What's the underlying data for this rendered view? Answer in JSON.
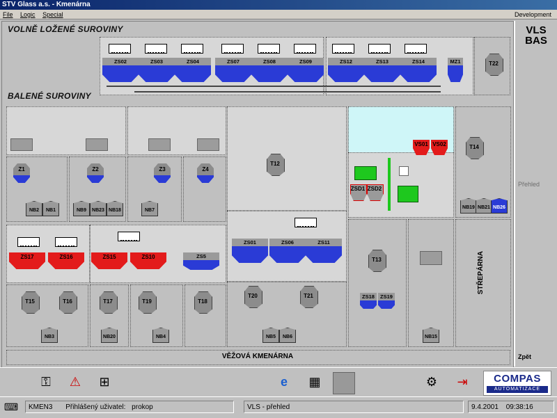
{
  "window": {
    "title": "STV Glass a.s. - Kmenárna"
  },
  "menu": {
    "items": [
      "File",
      "Logic",
      "Special"
    ],
    "right": "Development"
  },
  "headers": {
    "loose": "VOLNĚ LOŽENÉ SUROVINY",
    "packed": "BALENÉ SUROVINY",
    "tower": "VĚŽOVÁ KMENÁRNA",
    "strep": "STŘEPÁRNA"
  },
  "top_bins": {
    "g1": [
      "ZS02",
      "ZS03",
      "ZS04"
    ],
    "g2": [
      "ZS07",
      "ZS08",
      "ZS09"
    ],
    "g3": [
      "ZS12",
      "ZS13",
      "ZS14"
    ],
    "mz": "MZ1",
    "t22": "T22"
  },
  "z_tanks": [
    "Z1",
    "Z2",
    "Z3",
    "Z4"
  ],
  "nb_row1": [
    "NB2",
    "NB1",
    "NB9",
    "NB23",
    "NB18",
    "NB7"
  ],
  "red_bins": [
    "ZS17",
    "ZS16",
    "ZS15",
    "ZS10"
  ],
  "zs5": "ZS5",
  "t_lower_left": [
    "T15",
    "T16",
    "T17",
    "T19",
    "T18"
  ],
  "nb_lower_left": [
    "NB3",
    "NB20",
    "NB4"
  ],
  "center": {
    "t12": "T12",
    "bins": [
      "ZS01",
      "ZS06",
      "ZS11"
    ],
    "t20": "T20",
    "t21": "T21",
    "nb": [
      "NB5",
      "NB6"
    ]
  },
  "cyan_area": {
    "vs": [
      "VS01",
      "VS02"
    ],
    "zsd": [
      "ZSD1",
      "ZSD2"
    ]
  },
  "right_col": {
    "t14": "T14",
    "nb": [
      "NB19",
      "NB21",
      "NB26"
    ],
    "t13": "T13",
    "zs": [
      "ZS18",
      "ZS19"
    ],
    "nb15": "NB15"
  },
  "right_panel": {
    "title_line1": "VLS",
    "title_line2": "BAS",
    "prehled": "Přehled",
    "zpet": "Zpět"
  },
  "taskbar": {
    "icons": [
      "keys-icon",
      "warning-icon",
      "network-icon",
      "ie-icon",
      "calculator-icon",
      "blank-icon",
      "tools-icon",
      "exit-icon"
    ]
  },
  "logo": {
    "name": "COMPAS",
    "sub": "AUTOMATIZACE"
  },
  "status": {
    "station": "KMEN3",
    "user_label": "Přihlášený uživatel:",
    "user": "prokop",
    "screen": "VLS - přehled",
    "date": "9.4.2001",
    "time": "09:38:16"
  }
}
